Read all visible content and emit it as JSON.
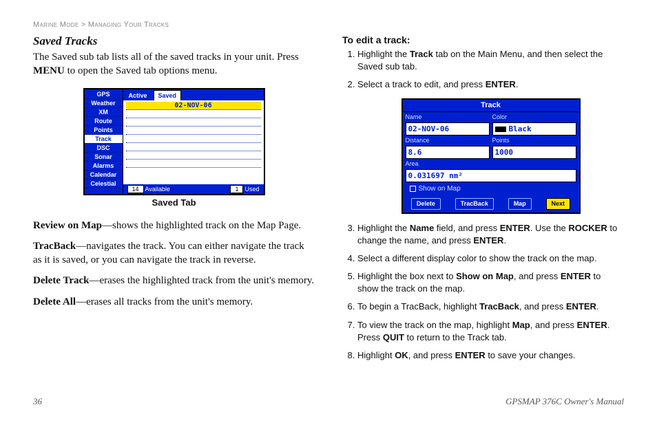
{
  "breadcrumb": {
    "section": "Marine Mode",
    "sep": ">",
    "page": "Managing Your Tracks"
  },
  "left": {
    "title": "Saved Tracks",
    "intro_pre": "The Saved sub tab lists all of the saved tracks in your unit. Press ",
    "intro_bold": "MENU",
    "intro_post": " to open the Saved tab options menu.",
    "caption": "Saved Tab",
    "defs": [
      {
        "term": "Review on Map",
        "text": "—shows the highlighted track on the Map Page."
      },
      {
        "term": "TracBack",
        "text": "—navigates the track. You can either navigate the track as it is saved, or you can navigate the track in reverse."
      },
      {
        "term": "Delete Track",
        "text": "—erases the highlighted track from the unit's memory."
      },
      {
        "term": "Delete All",
        "text": "—erases all tracks from the unit's memory."
      }
    ]
  },
  "fig1": {
    "sidebar": [
      "GPS",
      "Weather",
      "XM",
      "Route",
      "Points",
      "Track",
      "DSC",
      "Sonar",
      "Alarms",
      "Calendar",
      "Celestial"
    ],
    "sidebar_selected": "Track",
    "tabs": [
      "Active",
      "Saved"
    ],
    "tab_selected": "Saved",
    "selected_track": "02-NOV-06",
    "available_count": "14",
    "available_label": "Available",
    "used_count": "1",
    "used_label": "Used"
  },
  "right": {
    "title": "To edit a track:",
    "steps": [
      {
        "pre": "Highlight the ",
        "b1": "Track",
        "mid": " tab on the Main Menu, and then select the Saved sub tab.",
        "b2": "",
        "post": ""
      },
      {
        "pre": "Select a track to edit, and press ",
        "b1": "ENTER",
        "mid": ".",
        "b2": "",
        "post": ""
      },
      {
        "pre": "Highlight the ",
        "b1": "Name",
        "mid": " field, and press ",
        "b2": "ENTER",
        "post": ". Use the ",
        "b3": "ROCKER",
        "post2": " to change the name, and press ",
        "b4": "ENTER",
        "post3": "."
      },
      {
        "pre": "Select a different display color to show the track on the map.",
        "b1": "",
        "mid": "",
        "b2": "",
        "post": ""
      },
      {
        "pre": "Highlight the box next to ",
        "b1": "Show on Map",
        "mid": ", and press ",
        "b2": "ENTER",
        "post": " to show the track on the map."
      },
      {
        "pre": "To begin a TracBack, highlight ",
        "b1": "TracBack",
        "mid": ", and press ",
        "b2": "ENTER",
        "post": "."
      },
      {
        "pre": "To view the track on the map, highlight ",
        "b1": "Map",
        "mid": ", and press ",
        "b2": "ENTER",
        "post": ". Press ",
        "b3": "QUIT",
        "post2": " to return to the Track tab."
      },
      {
        "pre": "Highlight ",
        "b1": "OK",
        "mid": ", and press ",
        "b2": "ENTER",
        "post": " to save your changes."
      }
    ]
  },
  "fig2": {
    "title": "Track",
    "name_label": "Name",
    "name_value": "02-NOV-06",
    "color_label": "Color",
    "color_value": "Black",
    "distance_label": "Distance",
    "distance_value": "8.6",
    "points_label": "Points",
    "points_value": "1000",
    "area_label": "Area",
    "area_value": "0.031697  nm²",
    "show_label": "Show on Map",
    "buttons": [
      "Delete",
      "TracBack",
      "Map",
      "Next"
    ],
    "button_hi": "Next"
  },
  "footer": {
    "page": "36",
    "doc": "GPSMAP 376C Owner's Manual"
  }
}
